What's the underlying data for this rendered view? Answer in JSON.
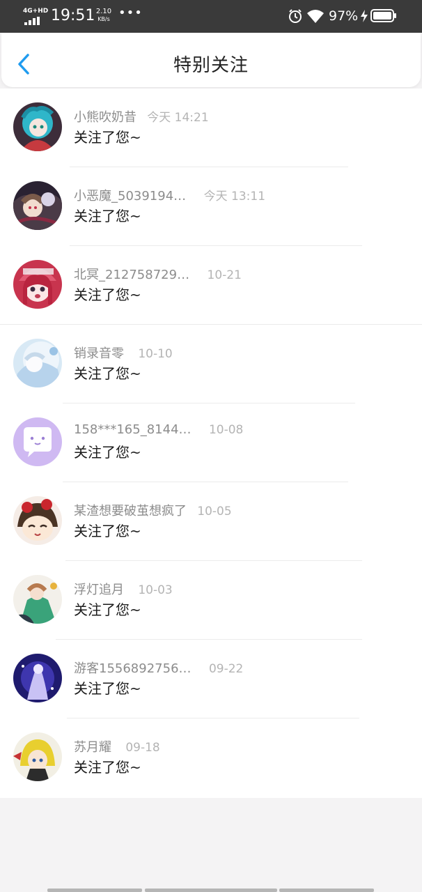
{
  "status_bar": {
    "network": "4G+HD",
    "time": "19:51",
    "speed_value": "2.10",
    "speed_unit": "KB/s",
    "more": "•••",
    "battery": "97%"
  },
  "header": {
    "title": "特别关注",
    "back_icon": "chevron-left-icon",
    "accent": "#1f9bef"
  },
  "items": [
    {
      "name": "小熊吹奶昔",
      "time": "今天 14:21",
      "message": "关注了您~"
    },
    {
      "name": "小恶魔_5039194…",
      "time": "今天 13:11",
      "message": "关注了您~"
    },
    {
      "name": "北冥_212758729…",
      "time": "10-21",
      "message": "关注了您~"
    },
    {
      "name": "销录音零",
      "time": "10-10",
      "message": "关注了您~"
    },
    {
      "name": "158***165_8144…",
      "time": "10-08",
      "message": "关注了您~"
    },
    {
      "name": "某渣想要破茧想疯了",
      "time": "10-05",
      "message": "关注了您~"
    },
    {
      "name": "浮灯追月",
      "time": "10-03",
      "message": "关注了您~"
    },
    {
      "name": "游客1556892756…",
      "time": "09-22",
      "message": "关注了您~"
    },
    {
      "name": "苏月耀",
      "time": "09-18",
      "message": "关注了您~"
    }
  ]
}
